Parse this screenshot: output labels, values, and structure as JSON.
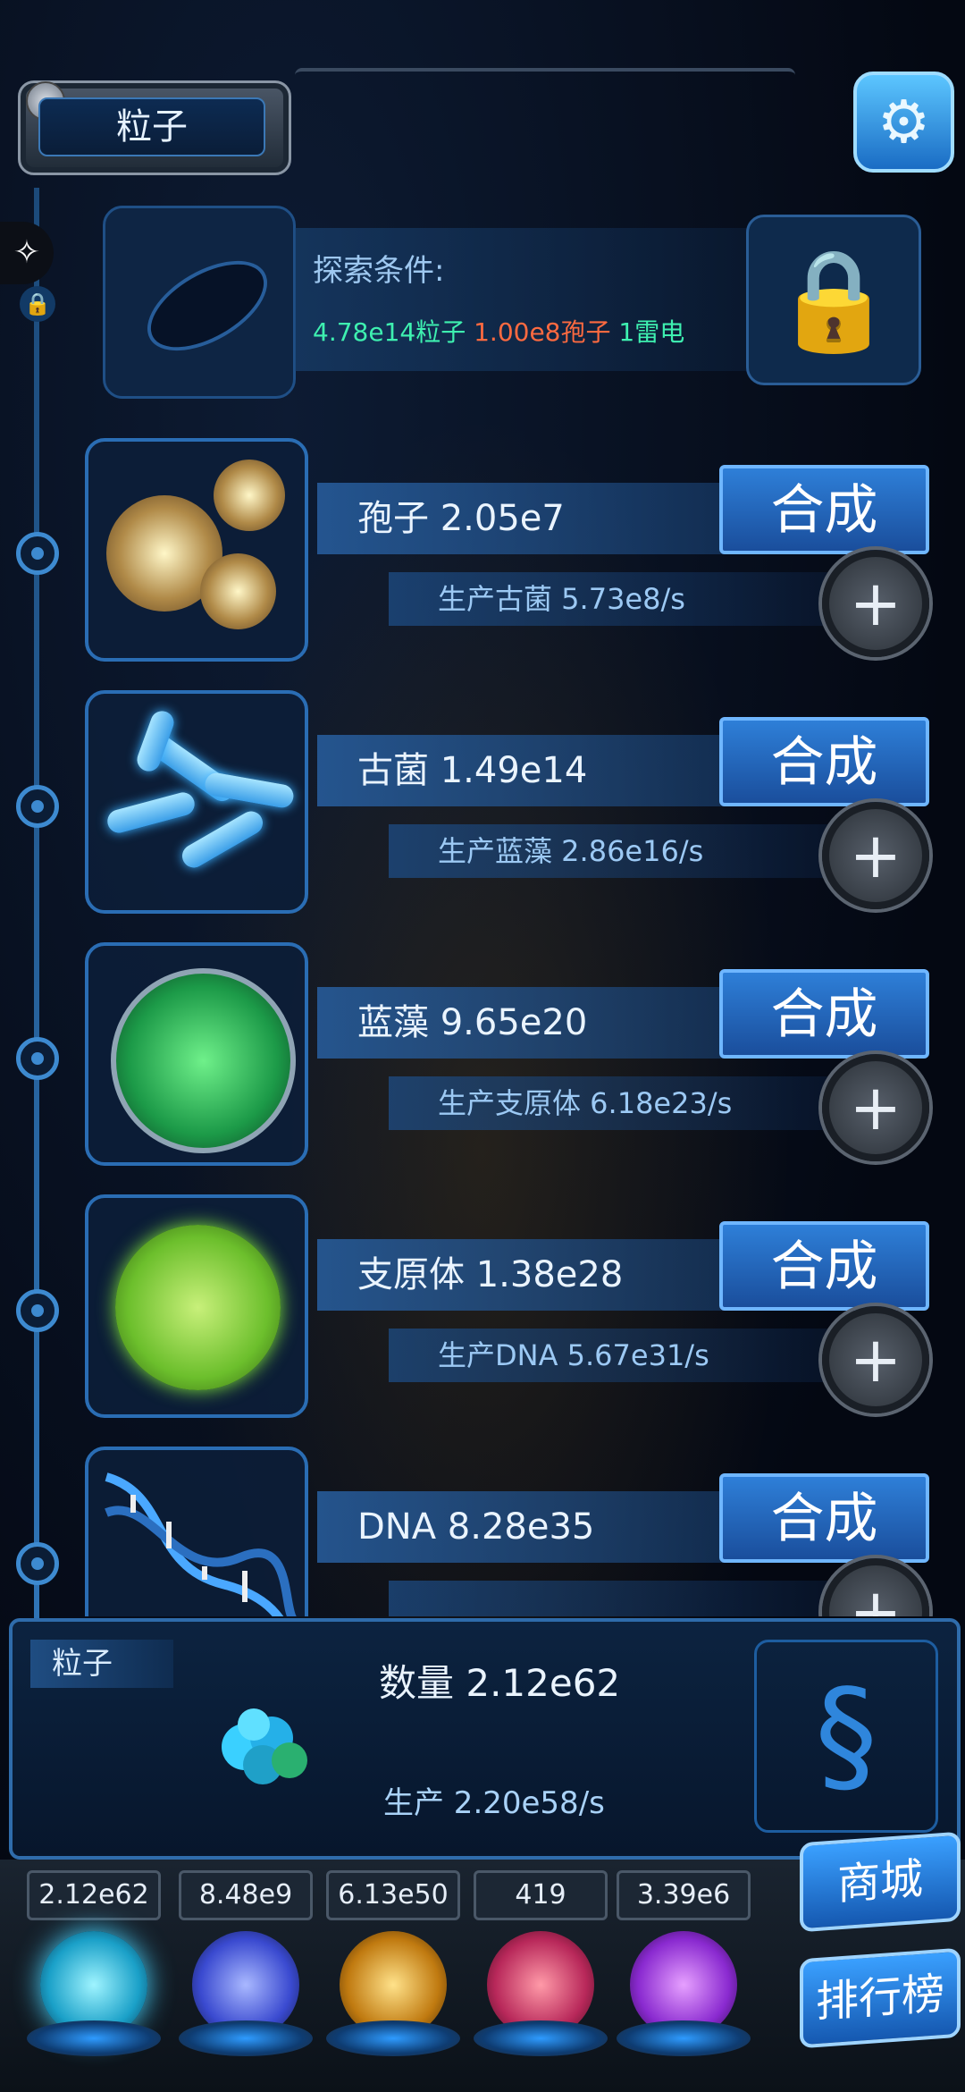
{
  "header": {
    "title": "粒子",
    "settings_icon": "gear-icon"
  },
  "explore": {
    "label": "探索条件:",
    "req_particles": "4.78e14粒子",
    "req_spores": "1.00e8孢子",
    "req_lightning": "1雷电"
  },
  "items": [
    {
      "name": "孢子 2.05e7",
      "production": "生产古菌 5.73e8/s",
      "synth_label": "合成"
    },
    {
      "name": "古菌 1.49e14",
      "production": "生产蓝藻 2.86e16/s",
      "synth_label": "合成"
    },
    {
      "name": "蓝藻 9.65e20",
      "production": "生产支原体 6.18e23/s",
      "synth_label": "合成"
    },
    {
      "name": "支原体 1.38e28",
      "production": "生产DNA 5.67e31/s",
      "synth_label": "合成"
    },
    {
      "name": "DNA 8.28e35",
      "production": "",
      "synth_label": "合成"
    }
  ],
  "panel": {
    "tag": "粒子",
    "count": "数量 2.12e62",
    "production": "生产 2.20e58/s"
  },
  "resources": [
    "2.12e62",
    "8.48e9",
    "6.13e50",
    "419",
    "3.39e6"
  ],
  "buttons": {
    "shop": "商城",
    "rank": "排行榜"
  },
  "colors": {
    "accent": "#2e7fd8",
    "req_green": "#3ef0b0",
    "req_red": "#ff6a40"
  }
}
